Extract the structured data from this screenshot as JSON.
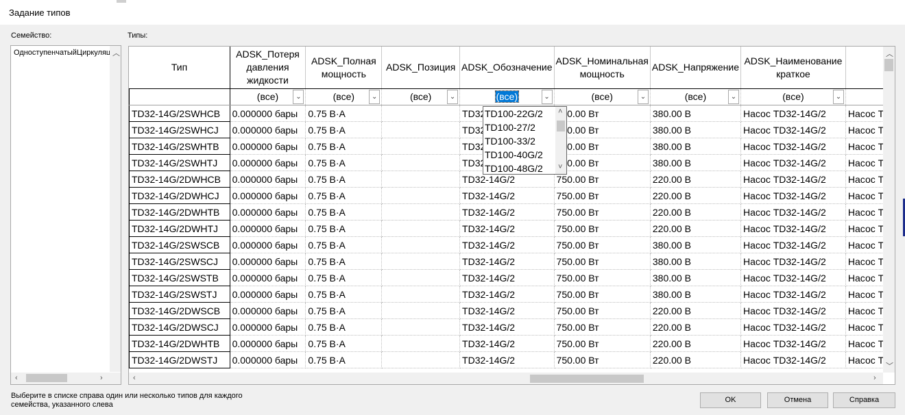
{
  "window": {
    "title": "Задание типов"
  },
  "family": {
    "label": "Семейство:",
    "items": [
      "ОдноступенчатыйЦиркуляционный"
    ]
  },
  "types": {
    "label": "Типы:",
    "columns": [
      "Тип",
      "ADSK_Потеря давления жидкости",
      "ADSK_Полная мощность",
      "ADSK_Позиция",
      "ADSK_Обозначение",
      "ADSK_Номинальная мощность",
      "ADSK_Напряжение",
      "ADSK_Наименование краткое",
      ""
    ],
    "filters": [
      "",
      "(все)",
      "(все)",
      "(все)",
      "(все)",
      "(все)",
      "(все)",
      "(все)",
      ""
    ],
    "rows": [
      [
        "TD32-14G/2SWHCB",
        "0.000000 бары",
        "0.75 В·А",
        "",
        "TD32-14G/2",
        "750.00 Вт",
        "380.00 В",
        "Насос TD32-14G/2",
        "Насос TI"
      ],
      [
        "TD32-14G/2SWHCJ",
        "0.000000 бары",
        "0.75 В·А",
        "",
        "TD32-14G/2",
        "750.00 Вт",
        "380.00 В",
        "Насос TD32-14G/2",
        "Насос TI"
      ],
      [
        "TD32-14G/2SWHTB",
        "0.000000 бары",
        "0.75 В·А",
        "",
        "TD32-14G/2",
        "750.00 Вт",
        "380.00 В",
        "Насос TD32-14G/2",
        "Насос TI"
      ],
      [
        "TD32-14G/2SWHTJ",
        "0.000000 бары",
        "0.75 В·А",
        "",
        "TD32-14G/2",
        "750.00 Вт",
        "380.00 В",
        "Насос TD32-14G/2",
        "Насос TI"
      ],
      [
        "TD32-14G/2DWHCB",
        "0.000000 бары",
        "0.75 В·А",
        "",
        "TD32-14G/2",
        "750.00 Вт",
        "220.00 В",
        "Насос TD32-14G/2",
        "Насос TI"
      ],
      [
        "TD32-14G/2DWHCJ",
        "0.000000 бары",
        "0.75 В·А",
        "",
        "TD32-14G/2",
        "750.00 Вт",
        "220.00 В",
        "Насос TD32-14G/2",
        "Насос TI"
      ],
      [
        "TD32-14G/2DWHTB",
        "0.000000 бары",
        "0.75 В·А",
        "",
        "TD32-14G/2",
        "750.00 Вт",
        "220.00 В",
        "Насос TD32-14G/2",
        "Насос TI"
      ],
      [
        "TD32-14G/2DWHTJ",
        "0.000000 бары",
        "0.75 В·А",
        "",
        "TD32-14G/2",
        "750.00 Вт",
        "220.00 В",
        "Насос TD32-14G/2",
        "Насос TI"
      ],
      [
        "TD32-14G/2SWSCB",
        "0.000000 бары",
        "0.75 В·А",
        "",
        "TD32-14G/2",
        "750.00 Вт",
        "380.00 В",
        "Насос TD32-14G/2",
        "Насос TI"
      ],
      [
        "TD32-14G/2SWSCJ",
        "0.000000 бары",
        "0.75 В·А",
        "",
        "TD32-14G/2",
        "750.00 Вт",
        "380.00 В",
        "Насос TD32-14G/2",
        "Насос TI"
      ],
      [
        "TD32-14G/2SWSTB",
        "0.000000 бары",
        "0.75 В·А",
        "",
        "TD32-14G/2",
        "750.00 Вт",
        "380.00 В",
        "Насос TD32-14G/2",
        "Насос TI"
      ],
      [
        "TD32-14G/2SWSTJ",
        "0.000000 бары",
        "0.75 В·А",
        "",
        "TD32-14G/2",
        "750.00 Вт",
        "380.00 В",
        "Насос TD32-14G/2",
        "Насос TI"
      ],
      [
        "TD32-14G/2DWSCB",
        "0.000000 бары",
        "0.75 В·А",
        "",
        "TD32-14G/2",
        "750.00 Вт",
        "220.00 В",
        "Насос TD32-14G/2",
        "Насос TI"
      ],
      [
        "TD32-14G/2DWSCJ",
        "0.000000 бары",
        "0.75 В·А",
        "",
        "TD32-14G/2",
        "750.00 Вт",
        "220.00 В",
        "Насос TD32-14G/2",
        "Насос TI"
      ],
      [
        "TD32-14G/2DWHTB",
        "0.000000 бары",
        "0.75 В·А",
        "",
        "TD32-14G/2",
        "750.00 Вт",
        "220.00 В",
        "Насос TD32-14G/2",
        "Насос TI"
      ],
      [
        "TD32-14G/2DWSTJ",
        "0.000000 бары",
        "0.75 В·А",
        "",
        "TD32-14G/2",
        "750.00 Вт",
        "220.00 В",
        "Насос TD32-14G/2",
        "Насос TI"
      ]
    ]
  },
  "dropdown": {
    "options": [
      "TD100-22G/2",
      "TD100-27/2",
      "TD100-33/2",
      "TD100-40G/2",
      "TD100-48G/2"
    ]
  },
  "footer": {
    "hint": "Выберите в списке справа один или несколько типов для каждого семейства, указанного слева",
    "ok": "OK",
    "cancel": "Отмена",
    "help": "Справка"
  },
  "colors": {
    "selection": "#0078d7",
    "accent_bar": "#1a2a8a"
  }
}
